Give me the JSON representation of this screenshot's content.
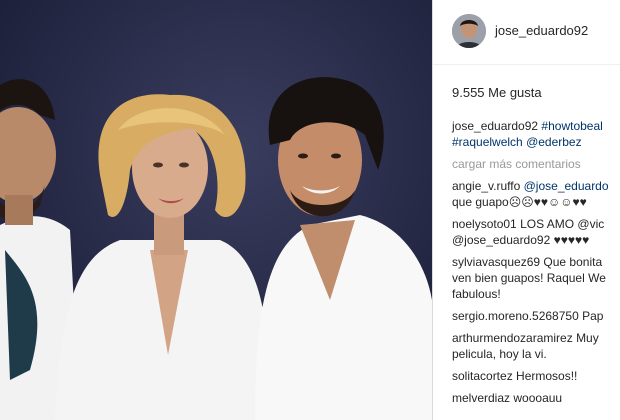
{
  "post": {
    "username": "jose_eduardo92",
    "likes": "9.555 Me gusta",
    "caption": {
      "user": "jose_eduardo92",
      "line1": "#howtobeal",
      "line2a": "#raquelwelch",
      "line2b": "@ederbez"
    },
    "load_more": "cargar más comentarios",
    "comments": [
      {
        "user": "angie_v.ruffo",
        "line1": "@jose_eduardo",
        "line2": "que guapo☹☹♥♥☺☺♥♥"
      },
      {
        "user": "noelysoto01",
        "line1": "LOS AMO @vic",
        "line2": "@jose_eduardo92 ♥♥♥♥♥"
      },
      {
        "user": "sylviavasquez69",
        "line1": "Que bonita",
        "line2": "ven bien guapos! Raquel We",
        "line3": "fabulous!"
      },
      {
        "user": "sergio.moreno.5268750",
        "line1": "Pap"
      },
      {
        "user": "arthurmendozaramirez",
        "line1": "Muy",
        "line2": "pelicula, hoy la vi."
      },
      {
        "user": "solitacortez",
        "line1": "Hermosos!!"
      },
      {
        "user": "melverdiaz",
        "line1": "woooauu"
      }
    ]
  },
  "colors": {
    "link": "#003569",
    "muted": "#999999",
    "text": "#262626",
    "photo_bg": "#222542"
  }
}
